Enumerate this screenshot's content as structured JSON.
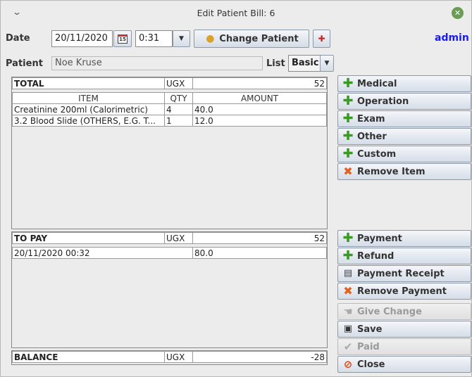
{
  "window": {
    "title": "Edit Patient Bill: 6",
    "user": "admin"
  },
  "header": {
    "date_label": "Date",
    "date_value": "20/11/2020",
    "time_value": "0:31",
    "change_patient_label": "Change Patient",
    "patient_label": "Patient",
    "patient_value": "Noe Kruse",
    "list_label": "List",
    "list_value": "Basic"
  },
  "items": {
    "total_label": "TOTAL",
    "currency": "UGX",
    "total_value": "52",
    "columns": [
      "ITEM",
      "QTY",
      "AMOUNT"
    ],
    "rows": [
      {
        "item": "Creatinine 200ml (Calorimetric)",
        "qty": "4",
        "amount": "40.0"
      },
      {
        "item": "3.2 Blood Slide (OTHERS, E.G. T...",
        "qty": "1",
        "amount": "12.0"
      }
    ]
  },
  "payments": {
    "topay_label": "TO PAY",
    "currency": "UGX",
    "topay_value": "52",
    "rows": [
      {
        "date": "20/11/2020 00:32",
        "amount": "80.0"
      }
    ]
  },
  "balance": {
    "label": "BALANCE",
    "currency": "UGX",
    "value": "-28"
  },
  "actions": {
    "medical": "Medical",
    "operation": "Operation",
    "exam": "Exam",
    "other": "Other",
    "custom": "Custom",
    "remove_item": "Remove Item",
    "payment": "Payment",
    "refund": "Refund",
    "payment_receipt": "Payment Receipt",
    "remove_payment": "Remove Payment",
    "give_change": "Give Change",
    "save": "Save",
    "paid": "Paid",
    "close": "Close"
  }
}
